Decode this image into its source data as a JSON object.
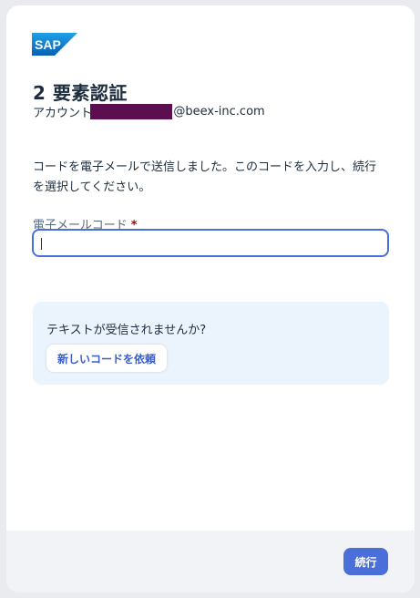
{
  "brand": {
    "logo_text": "SAP",
    "logo_color": "#2a7fd4"
  },
  "page": {
    "title": "2 要素認証",
    "account_prefix": "アカウント:",
    "account_domain": "@beex-inc.com",
    "instruction": "コードを電子メールで送信しました。このコードを入力し、続行を選択してください。"
  },
  "form": {
    "code_label": "電子メールコード",
    "required_marker": "*",
    "code_value": "",
    "code_placeholder": ""
  },
  "help": {
    "prompt": "テキストが受信されませんか?",
    "request_button_label": "新しいコードを依頼"
  },
  "footer": {
    "continue_label": "続行"
  },
  "colors": {
    "accent": "#4b6fd9",
    "info_background": "#ebf3fd",
    "required": "#aa0808",
    "redaction": "#5b0f4f"
  }
}
